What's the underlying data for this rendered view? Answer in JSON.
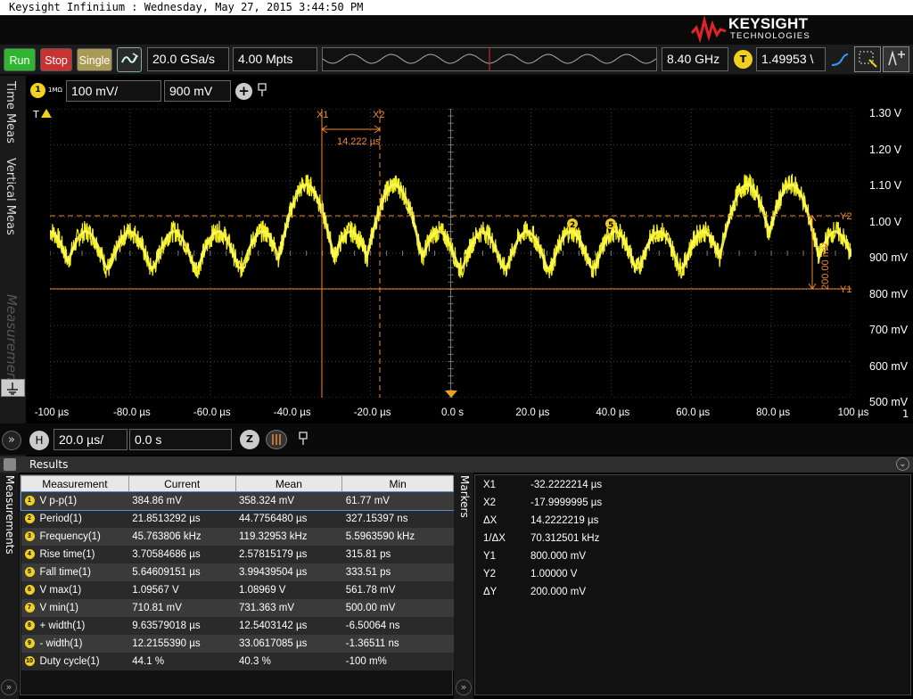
{
  "title_bar": "Keysight Infiniium : Wednesday, May 27, 2015 3:44:50 PM",
  "brand": {
    "name": "KEYSIGHT",
    "sub": "TECHNOLOGIES"
  },
  "controls": {
    "run": "Run",
    "stop": "Stop",
    "single": "Single",
    "sample_rate": "20.0 GSa/s",
    "memory_depth": "4.00 Mpts",
    "bandwidth": "8.40 GHz",
    "trigger_badge": "T",
    "trigger_level": "1.49953 \\"
  },
  "side_tabs": [
    "Time Meas",
    "Vertical Meas",
    "Measurements"
  ],
  "channel": {
    "number": "1",
    "impedance": "1MΩ",
    "scale": "100 mV/",
    "offset": "900 mV"
  },
  "scope": {
    "trigger_label": "T",
    "y_labels": [
      "1.30 V",
      "1.20 V",
      "1.10 V",
      "1.00 V",
      "900 mV",
      "800 mV",
      "700 mV",
      "600 mV",
      "500 mV"
    ],
    "x_labels": [
      "-100 µs",
      "-80.0 µs",
      "-60.0 µs",
      "-40.0 µs",
      "-20.0 µs",
      "0.0 s",
      "20.0 µs",
      "40.0 µs",
      "60.0 µs",
      "80.0 µs",
      "100 µs"
    ],
    "channel_num": "1",
    "x1_label": "X1",
    "x2_label": "X2",
    "dx_label": "14.222 µs",
    "y1_label": "Y1",
    "y2_label": "Y2",
    "dy_label": "200.00 mV",
    "marker_badges": [
      "2",
      "5"
    ]
  },
  "horizontal": {
    "badge": "H",
    "scale": "20.0 µs/",
    "position": "0.0 s"
  },
  "results": {
    "title": "Results",
    "side_label": "Measurements",
    "columns": [
      "Measurement",
      "Current",
      "Mean",
      "Min"
    ],
    "rows": [
      {
        "n": "1",
        "name": "V p-p(1)",
        "current": "384.86 mV",
        "mean": "358.324 mV",
        "min": "61.77 mV"
      },
      {
        "n": "2",
        "name": "Period(1)",
        "current": "21.8513292 µs",
        "mean": "44.7756480 µs",
        "min": "327.15397 ns"
      },
      {
        "n": "3",
        "name": "Frequency(1)",
        "current": "45.763806 kHz",
        "mean": "119.32953 kHz",
        "min": "5.5963590 kHz"
      },
      {
        "n": "4",
        "name": "Rise time(1)",
        "current": "3.70584686 µs",
        "mean": "2.57815179 µs",
        "min": "315.81 ps"
      },
      {
        "n": "5",
        "name": "Fall time(1)",
        "current": "5.64609151 µs",
        "mean": "3.99439504 µs",
        "min": "333.51 ps"
      },
      {
        "n": "6",
        "name": "V max(1)",
        "current": "1.09567 V",
        "mean": "1.08969 V",
        "min": "561.78 mV"
      },
      {
        "n": "7",
        "name": "V min(1)",
        "current": "710.81 mV",
        "mean": "731.363 mV",
        "min": "500.00 mV"
      },
      {
        "n": "8",
        "name": "+ width(1)",
        "current": "9.63579018 µs",
        "mean": "12.5403142 µs",
        "min": "-6.50064 ns"
      },
      {
        "n": "9",
        "name": "- width(1)",
        "current": "12.2155390 µs",
        "mean": "33.0617085 µs",
        "min": "-1.36511 ns"
      },
      {
        "n": "10",
        "name": "Duty cycle(1)",
        "current": "44.1 %",
        "mean": "40.3 %",
        "min": "-100 m%"
      }
    ]
  },
  "markers": {
    "side_label": "Markers",
    "rows": [
      {
        "label": "X1",
        "value": "-32.2222214 µs"
      },
      {
        "label": "X2",
        "value": "-17.9999995 µs"
      },
      {
        "label": "ΔX",
        "value": "14.2222219 µs"
      },
      {
        "label": "1/ΔX",
        "value": "70.312501 kHz"
      },
      {
        "label": "Y1",
        "value": "800.000 mV"
      },
      {
        "label": "Y2",
        "value": "1.00000 V"
      },
      {
        "label": "ΔY",
        "value": "200.000 mV"
      }
    ]
  },
  "colors": {
    "trace": "#f5f020",
    "marker": "#f08a30",
    "grid": "#555555"
  }
}
